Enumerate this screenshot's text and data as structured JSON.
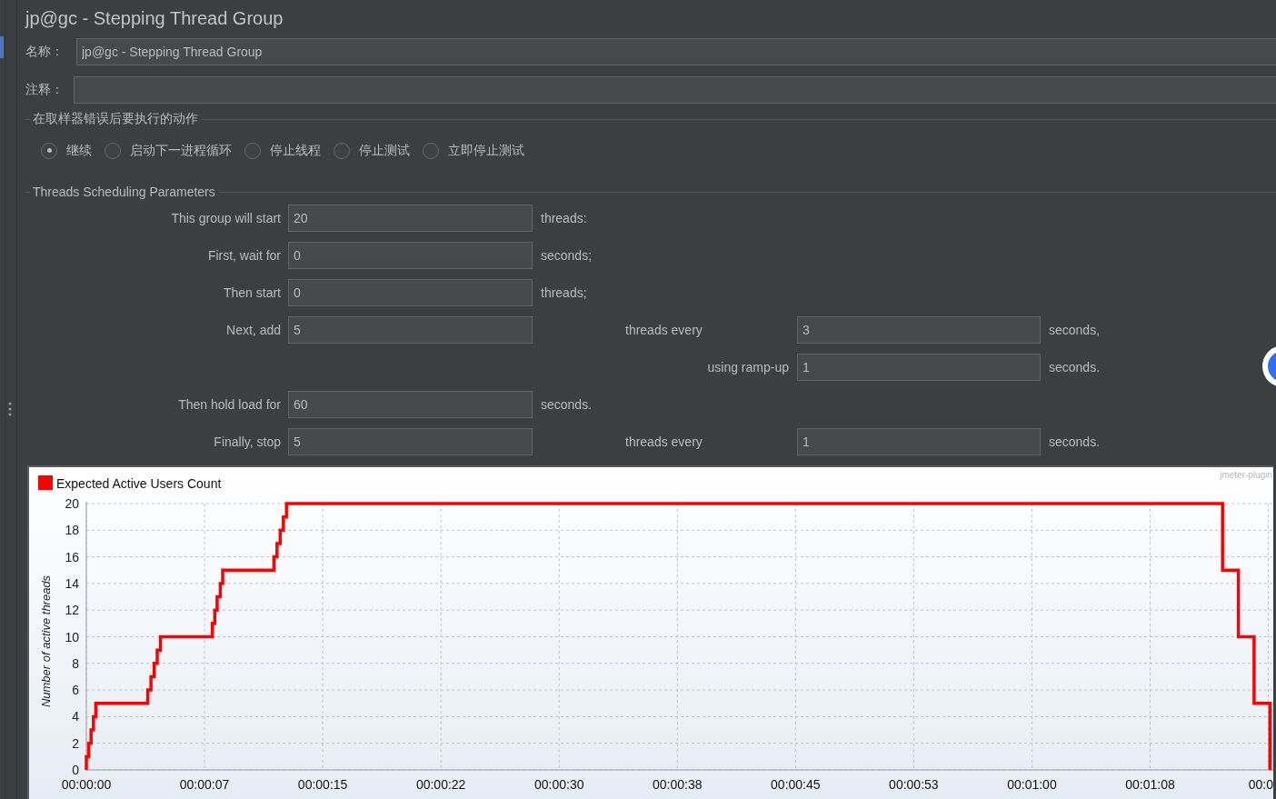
{
  "title": "jp@gc - Stepping Thread Group",
  "name_field": {
    "label": "名称：",
    "value": "jp@gc - Stepping Thread Group"
  },
  "comment_field": {
    "label": "注释："
  },
  "sampler_error_action": {
    "title": "在取样器错误后要执行的动作",
    "options": [
      {
        "label": "继续",
        "selected": true
      },
      {
        "label": "启动下一进程循环",
        "selected": false
      },
      {
        "label": "停止线程",
        "selected": false
      },
      {
        "label": "停止测试",
        "selected": false
      },
      {
        "label": "立即停止测试",
        "selected": false
      }
    ]
  },
  "scheduling": {
    "title": "Threads Scheduling Parameters",
    "rows": [
      {
        "label": "This group will start",
        "value": "20",
        "unit": "threads:"
      },
      {
        "label": "First, wait for",
        "value": "0",
        "unit": "seconds;"
      },
      {
        "label": "Then start",
        "value": "0",
        "unit": "threads;"
      },
      {
        "label": "Next, add",
        "value": "5",
        "label2": "threads every",
        "value2": "3",
        "unit2": "seconds,"
      },
      {
        "label2": "using ramp-up",
        "value2": "1",
        "unit2": "seconds."
      },
      {
        "label": "Then hold load for",
        "value": "60",
        "unit": "seconds."
      },
      {
        "label": "Finally, stop",
        "value": "5",
        "label2": "threads every",
        "value2": "1",
        "unit2": "seconds."
      }
    ]
  },
  "chart": {
    "corner_text": "jmeter-plugin",
    "chart_data": {
      "type": "line",
      "grid": true,
      "ylabel": "Number of active threads",
      "xlim": [
        0,
        75.2
      ],
      "ylim": [
        0,
        20
      ],
      "yticks": [
        0,
        2,
        4,
        6,
        8,
        10,
        12,
        14,
        16,
        18,
        20
      ],
      "xticks": [
        {
          "value": 0,
          "label": "00:00:00"
        },
        {
          "value": 7.5,
          "label": "00:00:07"
        },
        {
          "value": 15,
          "label": "00:00:15"
        },
        {
          "value": 22.5,
          "label": "00:00:22"
        },
        {
          "value": 30,
          "label": "00:00:30"
        },
        {
          "value": 37.5,
          "label": "00:00:38"
        },
        {
          "value": 45,
          "label": "00:00:45"
        },
        {
          "value": 52.5,
          "label": "00:00:53"
        },
        {
          "value": 60,
          "label": "00:01:00"
        },
        {
          "value": 67.5,
          "label": "00:01:08"
        },
        {
          "value": 75,
          "label": "00:0"
        }
      ],
      "x": [
        0,
        0,
        0.15,
        0.15,
        0.3,
        0.3,
        0.45,
        0.45,
        0.6,
        0.6,
        3.9,
        3.9,
        4.1,
        4.1,
        4.3,
        4.3,
        4.5,
        4.5,
        4.7,
        4.7,
        8.0,
        8.0,
        8.15,
        8.15,
        8.3,
        8.3,
        8.5,
        8.5,
        8.65,
        8.65,
        11.9,
        11.9,
        12.1,
        12.1,
        12.3,
        12.3,
        12.5,
        12.5,
        12.7,
        12.7,
        72.1,
        72.1,
        73.1,
        73.1,
        74.1,
        74.1,
        75.1,
        75.1
      ],
      "series": [
        {
          "name": "Expected Active Users Count",
          "color": "#ff0000",
          "values": [
            0,
            1,
            1,
            2,
            2,
            3,
            3,
            4,
            4,
            5,
            5,
            6,
            6,
            7,
            7,
            8,
            8,
            9,
            9,
            10,
            10,
            11,
            11,
            12,
            12,
            13,
            13,
            14,
            14,
            15,
            15,
            16,
            16,
            17,
            17,
            18,
            18,
            19,
            19,
            20,
            20,
            15,
            15,
            10,
            10,
            5,
            5,
            0
          ]
        }
      ]
    }
  }
}
